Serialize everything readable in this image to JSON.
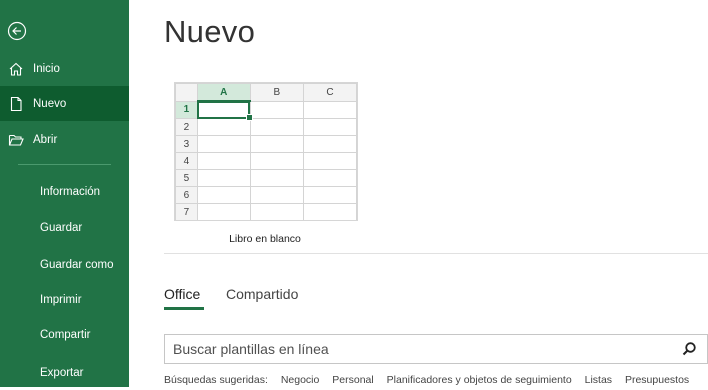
{
  "sidebar": {
    "back_icon": "back-arrow-circle-icon",
    "items": [
      {
        "label": "Inicio",
        "icon": "home-icon"
      },
      {
        "label": "Nuevo",
        "icon": "new-document-icon"
      },
      {
        "label": "Abrir",
        "icon": "folder-open-icon"
      }
    ],
    "text_items": [
      "Información",
      "Guardar",
      "Guardar como",
      "Imprimir",
      "Compartir",
      "Exportar"
    ],
    "colors": {
      "background": "#217346",
      "selected": "#0e5c2f"
    }
  },
  "main": {
    "title": "Nuevo",
    "template": {
      "label": "Libro en blanco",
      "columns": [
        "A",
        "B",
        "C"
      ],
      "rows": [
        "1",
        "2",
        "3",
        "4",
        "5",
        "6",
        "7"
      ]
    },
    "tabs": [
      {
        "label": "Office",
        "active": true
      },
      {
        "label": "Compartido",
        "active": false
      }
    ],
    "search": {
      "placeholder": "Buscar plantillas en línea",
      "icon": "search-icon"
    },
    "suggestions": {
      "label": "Búsquedas sugeridas:",
      "items": [
        "Negocio",
        "Personal",
        "Planificadores y objetos de seguimiento",
        "Listas",
        "Presupuestos"
      ]
    }
  }
}
